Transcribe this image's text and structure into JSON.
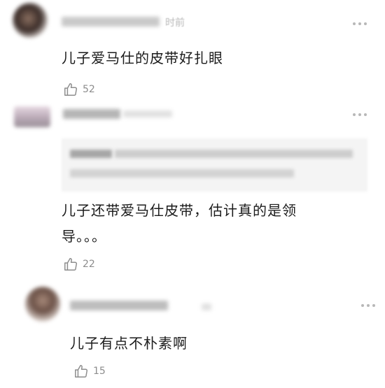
{
  "comments": [
    {
      "time": "时前",
      "text": "儿子爱马仕的皮带好扎眼",
      "likes": "52"
    },
    {
      "text_line1": "儿子还带爱马仕皮带，估计真的是领",
      "text_line2": "导。。。",
      "likes": "22"
    },
    {
      "text": "儿子有点不朴素啊",
      "likes": "15"
    }
  ],
  "icons": {
    "like": "thumbs-up-icon",
    "more": "more-dots-icon"
  }
}
